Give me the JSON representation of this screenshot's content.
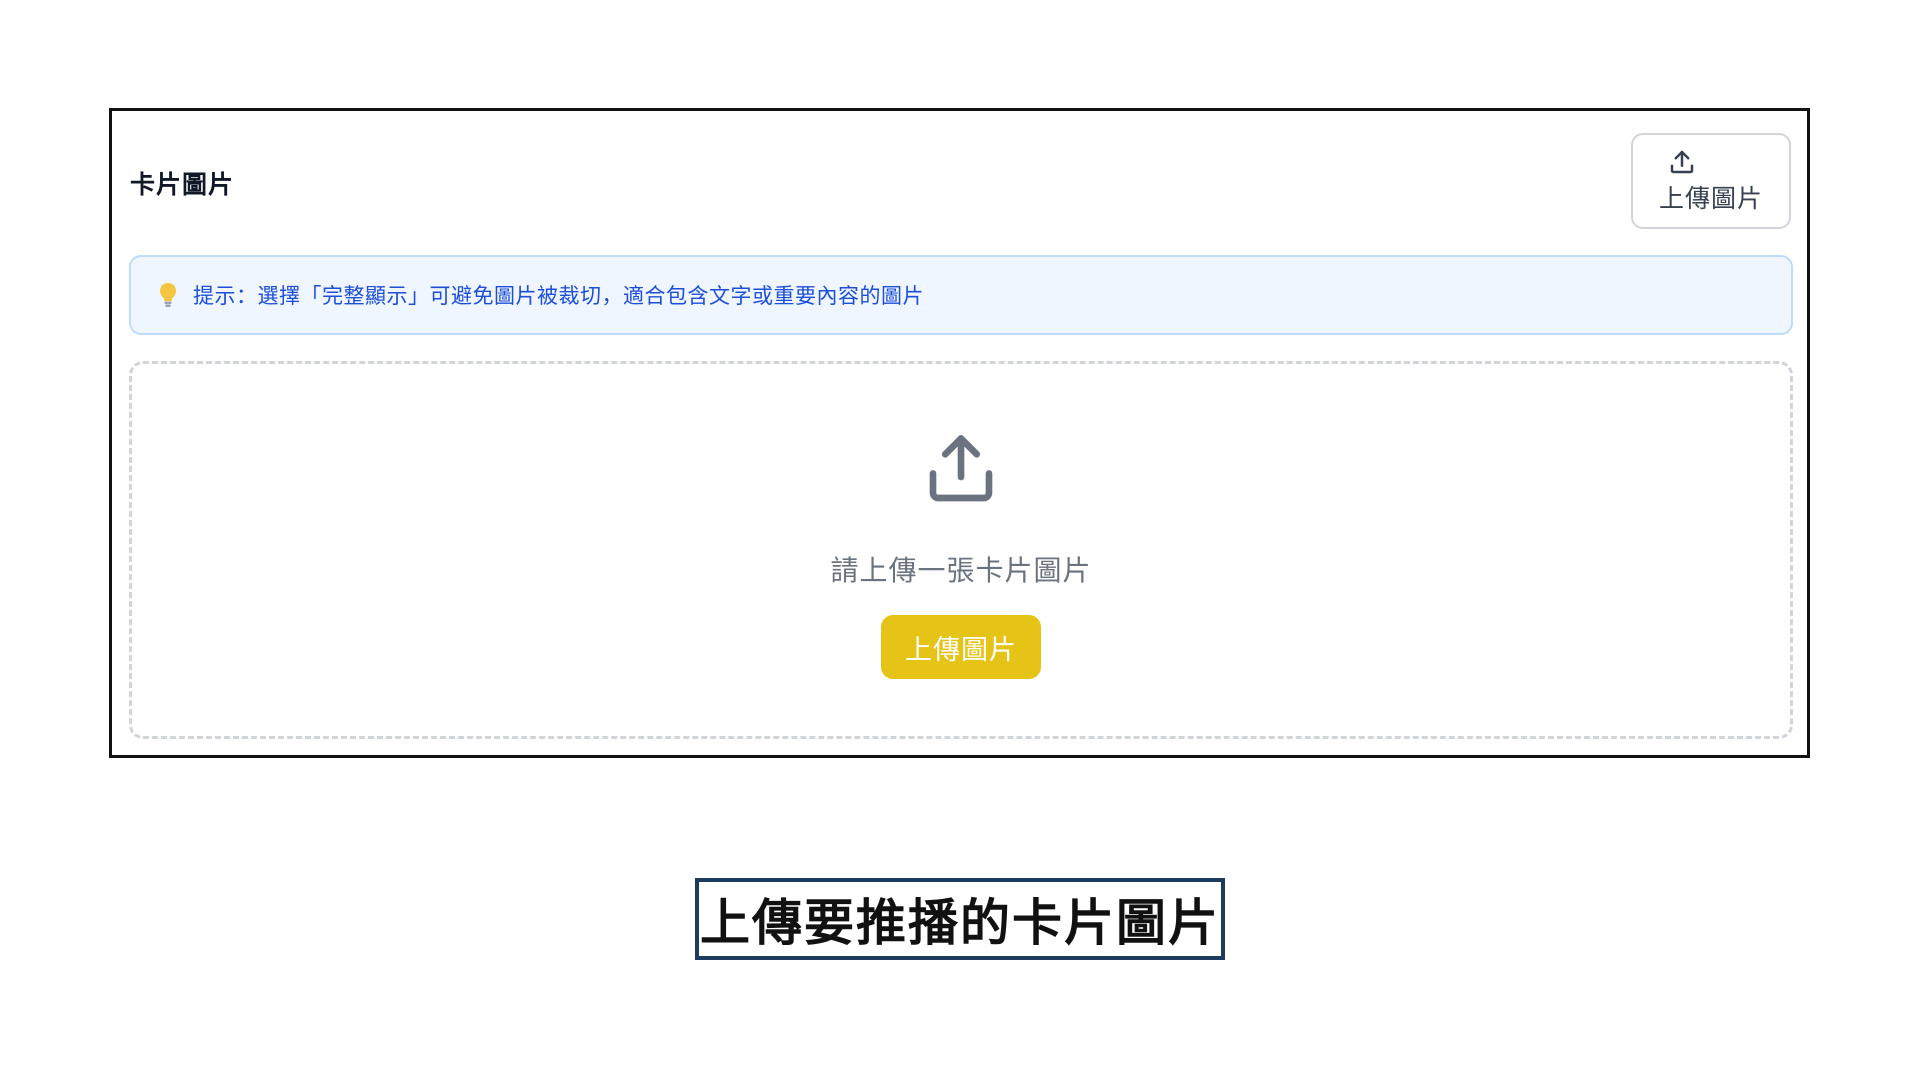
{
  "section": {
    "title": "卡片圖片"
  },
  "top_upload_button": {
    "icon": "upload-icon",
    "label": "上傳圖片"
  },
  "tip": {
    "icon": "lightbulb-icon",
    "text": "提示：選擇「完整顯示」可避免圖片被裁切，適合包含文字或重要內容的圖片"
  },
  "dropzone": {
    "icon": "upload-icon",
    "hint": "請上傳一張卡片圖片",
    "button_label": "上傳圖片"
  },
  "caption": {
    "text": "上傳要推播的卡片圖片"
  },
  "colors": {
    "accent_yellow": "#e6c317",
    "tip_background": "#eff6ff",
    "tip_border": "#bfdbfe",
    "tip_text": "#1d4ed8",
    "caption_border": "#1e3a5f"
  }
}
